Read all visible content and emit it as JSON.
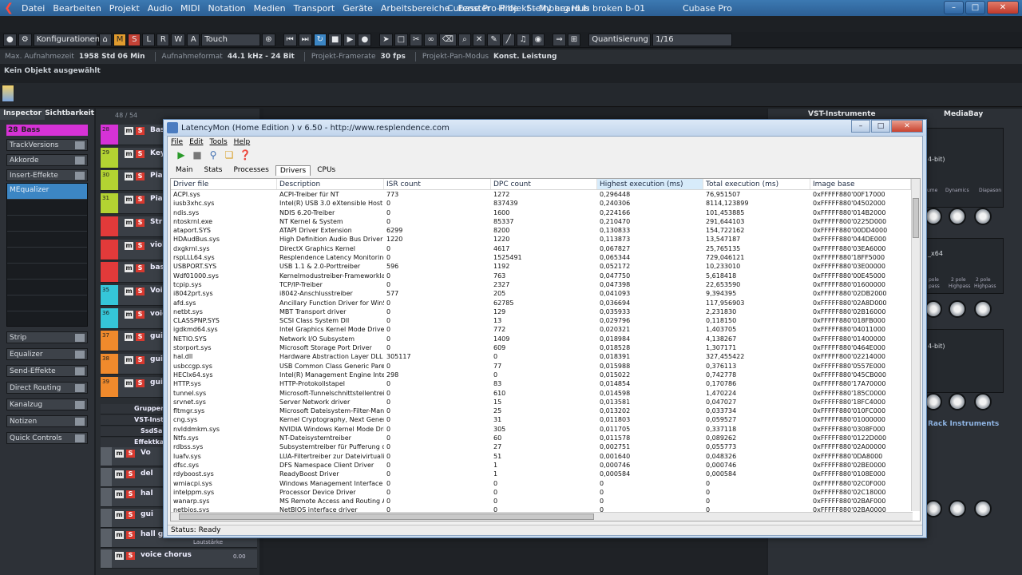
{
  "menubar": {
    "items": [
      "Datei",
      "Bearbeiten",
      "Projekt",
      "Audio",
      "MIDI",
      "Notation",
      "Medien",
      "Transport",
      "Geräte",
      "Arbeitsbereiche",
      "Fenster",
      "Hilfe",
      "Steinberg Hub"
    ],
    "app_name": "Cubase Pro"
  },
  "window": {
    "title": "Cubase Pro-Projekt - My heard is broken b-01"
  },
  "toolbar": {
    "config_label": "Konfigurationen",
    "mode_buttons": [
      "M",
      "S",
      "L",
      "R",
      "W",
      "A"
    ],
    "touch_label": "Touch",
    "quant_label": "Quantisierung",
    "quant_value": "1/16"
  },
  "statusline": {
    "max_rec_label": "Max. Aufnahmezeit",
    "max_rec_value": "1958 Std 06 Min",
    "rec_format_label": "Aufnahmeformat",
    "rec_format_value": "44.1 kHz - 24 Bit",
    "framerate_label": "Projekt-Framerate",
    "framerate_value": "30 fps",
    "pan_label": "Projekt-Pan-Modus",
    "pan_value": "Konst. Leistung"
  },
  "infoline": "Kein Objekt ausgewählt",
  "inspector": {
    "tabs": [
      "Inspector",
      "Sichtbarkeit"
    ],
    "track_number": "28",
    "track_name": "Bass",
    "sections_top": [
      "TrackVersions",
      "Akkorde",
      "Insert-Effekte"
    ],
    "insert_slot": "MEqualizer",
    "sections_bottom": [
      "Strip",
      "Equalizer",
      "Send-Effekte",
      "Direct Routing",
      "Kanalzug",
      "Notizen",
      "Quick Controls"
    ]
  },
  "tracklist": {
    "counter": "48 / 54",
    "tracks": [
      {
        "num": "28",
        "name": "Bass",
        "color": "#d632d6"
      },
      {
        "num": "29",
        "name": "Keys",
        "color": "#b3d332"
      },
      {
        "num": "30",
        "name": "Piano",
        "color": "#b3d332"
      },
      {
        "num": "31",
        "name": "Piano",
        "color": "#b3d332"
      },
      {
        "num": "",
        "name": "Strin",
        "color": "#e23a3a"
      },
      {
        "num": "",
        "name": "violi",
        "color": "#e23a3a"
      },
      {
        "num": "",
        "name": "bass",
        "color": "#e23a3a"
      },
      {
        "num": "35",
        "name": "Voic",
        "color": "#35c6d9"
      },
      {
        "num": "36",
        "name": "voic",
        "color": "#35c6d9"
      },
      {
        "num": "37",
        "name": "guita",
        "color": "#f08a2c"
      },
      {
        "num": "38",
        "name": "guita",
        "color": "#f08a2c"
      },
      {
        "num": "39",
        "name": "guit",
        "color": "#f08a2c"
      }
    ],
    "folders": [
      "Gruppenspu",
      "VST-Instrum",
      "SsdSampl",
      "Effektkanäle"
    ],
    "bottom_tracks": [
      "Vo",
      "del",
      "hal",
      "gui",
      "hall guit",
      "voice chorus"
    ],
    "volume_label": "Lautstärke",
    "volume_value": "0.00"
  },
  "rightpanel": {
    "vst_title": "VST-Instrumente",
    "mediabay_title": "MediaBay",
    "rack_title": "Rack Instruments",
    "plugin_labels": [
      "4-bit)",
      "_x64",
      "4-bit)"
    ],
    "knob_labels": [
      "ume",
      "Dynamics",
      "Diapason"
    ],
    "pole_labels": [
      "pole",
      "2 pole",
      "2 pole"
    ],
    "pass_labels": [
      "pass",
      "Highpass",
      "Highpass"
    ]
  },
  "latencymon": {
    "title": "LatencyMon  (Home Edition )  v 6.50 - http://www.resplendence.com",
    "menu": [
      "File",
      "Edit",
      "Tools",
      "Help"
    ],
    "tabs": [
      "Main",
      "Stats",
      "Processes",
      "Drivers",
      "CPUs"
    ],
    "active_tab": "Drivers",
    "columns": [
      "Driver file",
      "Description",
      "ISR count",
      "DPC count",
      "Highest execution (ms)",
      "Total execution (ms)",
      "Image base"
    ],
    "rows": [
      [
        "ACPI.sys",
        "ACPI-Treiber für NT",
        "773",
        "1272",
        "0,296448",
        "76,951507",
        "0xFFFFF880'00F17000"
      ],
      [
        "iusb3xhc.sys",
        "Intel(R) USB 3.0 eXtensible Host Co...",
        "0",
        "837439",
        "0,240306",
        "8114,123899",
        "0xFFFFF880'04502000"
      ],
      [
        "ndis.sys",
        "NDIS 6.20-Treiber",
        "0",
        "1600",
        "0,224166",
        "101,453885",
        "0xFFFFF880'014B2000"
      ],
      [
        "ntoskrnl.exe",
        "NT Kernel & System",
        "0",
        "85337",
        "0,210470",
        "291,644103",
        "0xFFFFF800'0225D000"
      ],
      [
        "ataport.SYS",
        "ATAPI Driver Extension",
        "6299",
        "8200",
        "0,130833",
        "154,722162",
        "0xFFFFF880'00DD4000"
      ],
      [
        "HDAudBus.sys",
        "High Definition Audio Bus Driver",
        "1220",
        "1220",
        "0,113873",
        "13,547187",
        "0xFFFFF880'044DE000"
      ],
      [
        "dxgkrnl.sys",
        "DirectX Graphics Kernel",
        "0",
        "4617",
        "0,067827",
        "25,765135",
        "0xFFFFF880'03EA6000"
      ],
      [
        "rspLLL64.sys",
        "Resplendence Latency Monitoring a...",
        "0",
        "1525491",
        "0,065344",
        "729,046121",
        "0xFFFFF880'18FF5000"
      ],
      [
        "USBPORT.SYS",
        "USB 1.1 & 2.0-Porttreiber",
        "596",
        "1192",
        "0,052172",
        "10,233010",
        "0xFFFFF880'03E00000"
      ],
      [
        "Wdf01000.sys",
        "Kernelmodustreiber-Frameworklaufzeit",
        "0",
        "763",
        "0,047750",
        "5,618418",
        "0xFFFFF880'00E45000"
      ],
      [
        "tcpip.sys",
        "TCP/IP-Treiber",
        "0",
        "2327",
        "0,047398",
        "22,653590",
        "0xFFFFF880'01600000"
      ],
      [
        "i8042prt.sys",
        "i8042-Anschlusstreiber",
        "577",
        "205",
        "0,041093",
        "9,394395",
        "0xFFFFF880'02DB2000"
      ],
      [
        "afd.sys",
        "Ancillary Function Driver for WinSock",
        "0",
        "62785",
        "0,036694",
        "117,956903",
        "0xFFFFF880'02A8D000"
      ],
      [
        "netbt.sys",
        "MBT Transport driver",
        "0",
        "129",
        "0,035933",
        "2,231830",
        "0xFFFFF880'02B16000"
      ],
      [
        "CLASSPNP.SYS",
        "SCSI Class System Dll",
        "0",
        "13",
        "0,029796",
        "0,118150",
        "0xFFFFF880'018FB000"
      ],
      [
        "igdkmd64.sys",
        "Intel Graphics Kernel Mode Driver",
        "0",
        "772",
        "0,020321",
        "1,403705",
        "0xFFFFF880'04011000"
      ],
      [
        "NETIO.SYS",
        "Network I/O Subsystem",
        "0",
        "1409",
        "0,018984",
        "4,138267",
        "0xFFFFF880'01400000"
      ],
      [
        "storport.sys",
        "Microsoft Storage Port Driver",
        "0",
        "609",
        "0,018528",
        "1,307171",
        "0xFFFFF880'0464E000"
      ],
      [
        "hal.dll",
        "Hardware Abstraction Layer DLL",
        "305117",
        "0",
        "0,018391",
        "327,455422",
        "0xFFFFF800'02214000"
      ],
      [
        "usbccgp.sys",
        "USB Common Class Generic Parent ...",
        "0",
        "77",
        "0,015988",
        "0,376113",
        "0xFFFFF880'0557E000"
      ],
      [
        "HECIx64.sys",
        "Intel(R) Management Engine Interface",
        "298",
        "0",
        "0,015022",
        "0,742778",
        "0xFFFFF880'045CB000"
      ],
      [
        "HTTP.sys",
        "HTTP-Protokollstapel",
        "0",
        "83",
        "0,014854",
        "0,170786",
        "0xFFFFF880'17A70000"
      ],
      [
        "tunnel.sys",
        "Microsoft-Tunnelschnittstellentreiber",
        "0",
        "610",
        "0,014598",
        "1,470224",
        "0xFFFFF880'185C0000"
      ],
      [
        "srvnet.sys",
        "Server Network driver",
        "0",
        "15",
        "0,013581",
        "0,047027",
        "0xFFFFF880'18FC4000"
      ],
      [
        "fltmgr.sys",
        "Microsoft Dateisystem-Filter-Manager",
        "0",
        "25",
        "0,013202",
        "0,033734",
        "0xFFFFF880'010FC000"
      ],
      [
        "cng.sys",
        "Kernel Cryptography, Next Generation",
        "0",
        "31",
        "0,011803",
        "0,059527",
        "0xFFFFF880'01000000"
      ],
      [
        "nvlddmkm.sys",
        "NVIDIA Windows Kernel Mode Drive...",
        "0",
        "305",
        "0,011705",
        "0,337118",
        "0xFFFFF880'0308F000"
      ],
      [
        "Ntfs.sys",
        "NT-Dateisystemtreiber",
        "0",
        "60",
        "0,011578",
        "0,089262",
        "0xFFFFF880'0122D000"
      ],
      [
        "rdbss.sys",
        "Subsystemtreiber für Pufferung des...",
        "0",
        "27",
        "0,002751",
        "0,055773",
        "0xFFFFF880'02A00000"
      ],
      [
        "luafv.sys",
        "LUA-Filtertreiber zur Dateivirtualisier...",
        "0",
        "51",
        "0,001640",
        "0,048326",
        "0xFFFFF880'0DA8000"
      ],
      [
        "dfsc.sys",
        "DFS Namespace Client Driver",
        "0",
        "1",
        "0,000746",
        "0,000746",
        "0xFFFFF880'02BE0000"
      ],
      [
        "rdyboost.sys",
        "ReadyBoost Driver",
        "0",
        "1",
        "0,000584",
        "0,000584",
        "0xFFFFF880'0108E000"
      ],
      [
        "wmiacpi.sys",
        "Windows Management Interface for...",
        "0",
        "0",
        "0",
        "0",
        "0xFFFFF880'02C0F000"
      ],
      [
        "intelppm.sys",
        "Processor Device Driver",
        "0",
        "0",
        "0",
        "0",
        "0xFFFFF880'02C18000"
      ],
      [
        "wanarp.sys",
        "MS Remote Access and Routing ARP...",
        "0",
        "0",
        "0",
        "0",
        "0xFFFFF880'02BAF000"
      ],
      [
        "netbios.sys",
        "NetBIOS interface driver",
        "0",
        "0",
        "0",
        "0",
        "0xFFFFF880'02BA0000"
      ]
    ],
    "status": "Status: Ready"
  }
}
